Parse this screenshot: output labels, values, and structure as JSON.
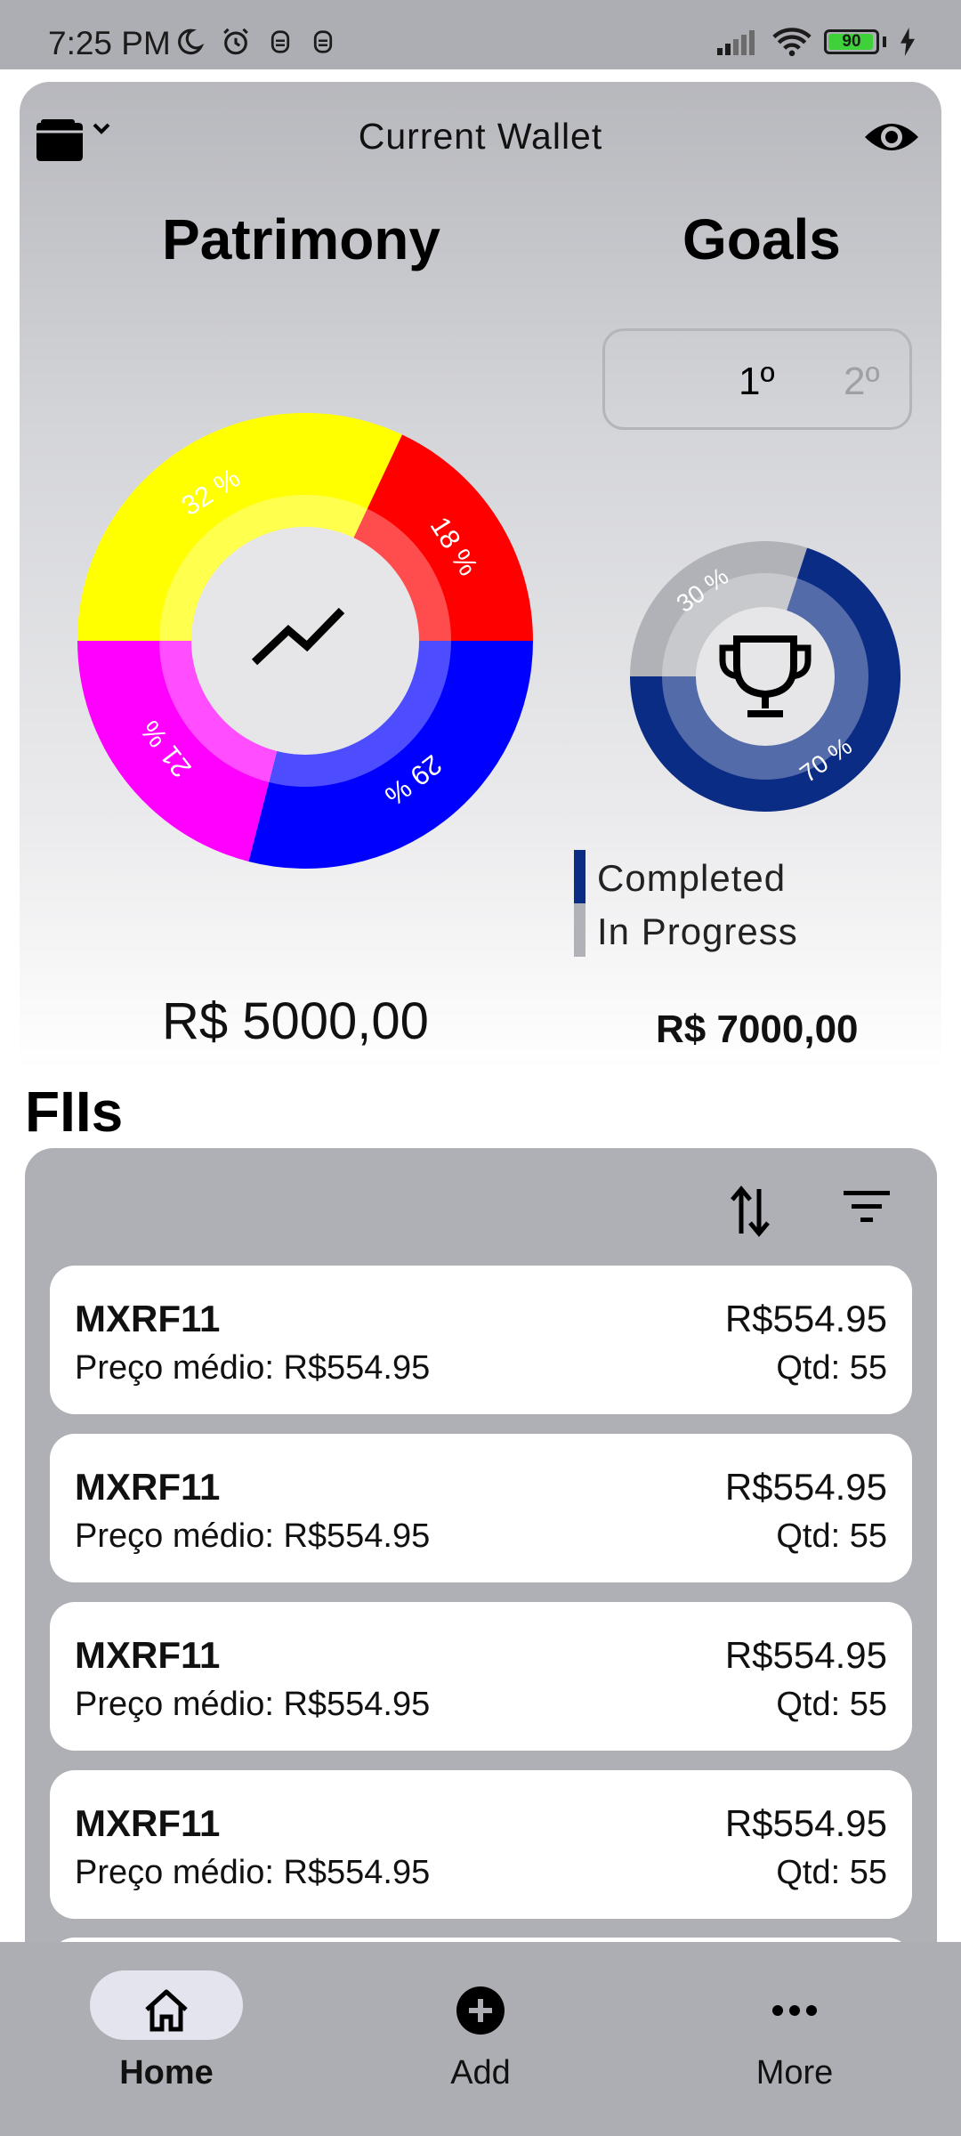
{
  "status_bar": {
    "time": "7:25 PM",
    "left_icons": [
      "moon-icon",
      "alarm-icon",
      "notification-icon",
      "notification-icon"
    ],
    "battery": "90",
    "right_icons": [
      "signal-icon",
      "wifi-icon",
      "battery-icon",
      "charging-icon"
    ]
  },
  "wallet": {
    "title": "Current Wallet",
    "toggle_icon": "wallet-icon",
    "visibility_icon": "eye-icon"
  },
  "patrimony": {
    "title": "Patrimony",
    "total": "R$ 5000,00",
    "center_icon": "trending-line-icon"
  },
  "goals": {
    "title": "Goals",
    "tabs": [
      {
        "label": "1º",
        "active": true
      },
      {
        "label": "2º",
        "active": false
      }
    ],
    "total": "R$ 7000,00",
    "center_icon": "trophy-icon",
    "legend": [
      {
        "label": "Completed",
        "color": "#0b2c85"
      },
      {
        "label": "In Progress",
        "color": "#b1b2b7"
      }
    ]
  },
  "chart_data": [
    {
      "type": "pie",
      "labels": [
        "32 %",
        "18 %",
        "29 %",
        "21 %"
      ],
      "values": [
        32,
        18,
        29,
        21
      ],
      "colors": [
        "#ffff00",
        "#ff0000",
        "#0000ff",
        "#ff00ff"
      ]
    },
    {
      "type": "pie",
      "labels": [
        "70 %",
        "30 %"
      ],
      "values": [
        70,
        30
      ],
      "colors": [
        "#0b2c85",
        "#b1b2b7"
      ]
    }
  ],
  "fiis": {
    "title": "FIIs",
    "sort_icon": "sort-icon",
    "filter_icon": "filter-icon",
    "items": [
      {
        "ticker": "MXRF11",
        "avg_price": "Preço médio: R$554.95",
        "price": "R$554.95",
        "qty": "Qtd: 55"
      },
      {
        "ticker": "MXRF11",
        "avg_price": "Preço médio: R$554.95",
        "price": "R$554.95",
        "qty": "Qtd: 55"
      },
      {
        "ticker": "MXRF11",
        "avg_price": "Preço médio: R$554.95",
        "price": "R$554.95",
        "qty": "Qtd: 55"
      },
      {
        "ticker": "MXRF11",
        "avg_price": "Preço médio: R$554.95",
        "price": "R$554.95",
        "qty": "Qtd: 55"
      }
    ]
  },
  "bottom_nav": {
    "items": [
      {
        "label": "Home",
        "icon": "home-icon",
        "active": true
      },
      {
        "label": "Add",
        "icon": "add-icon",
        "active": false
      },
      {
        "label": "More",
        "icon": "more-icon",
        "active": false
      }
    ]
  }
}
